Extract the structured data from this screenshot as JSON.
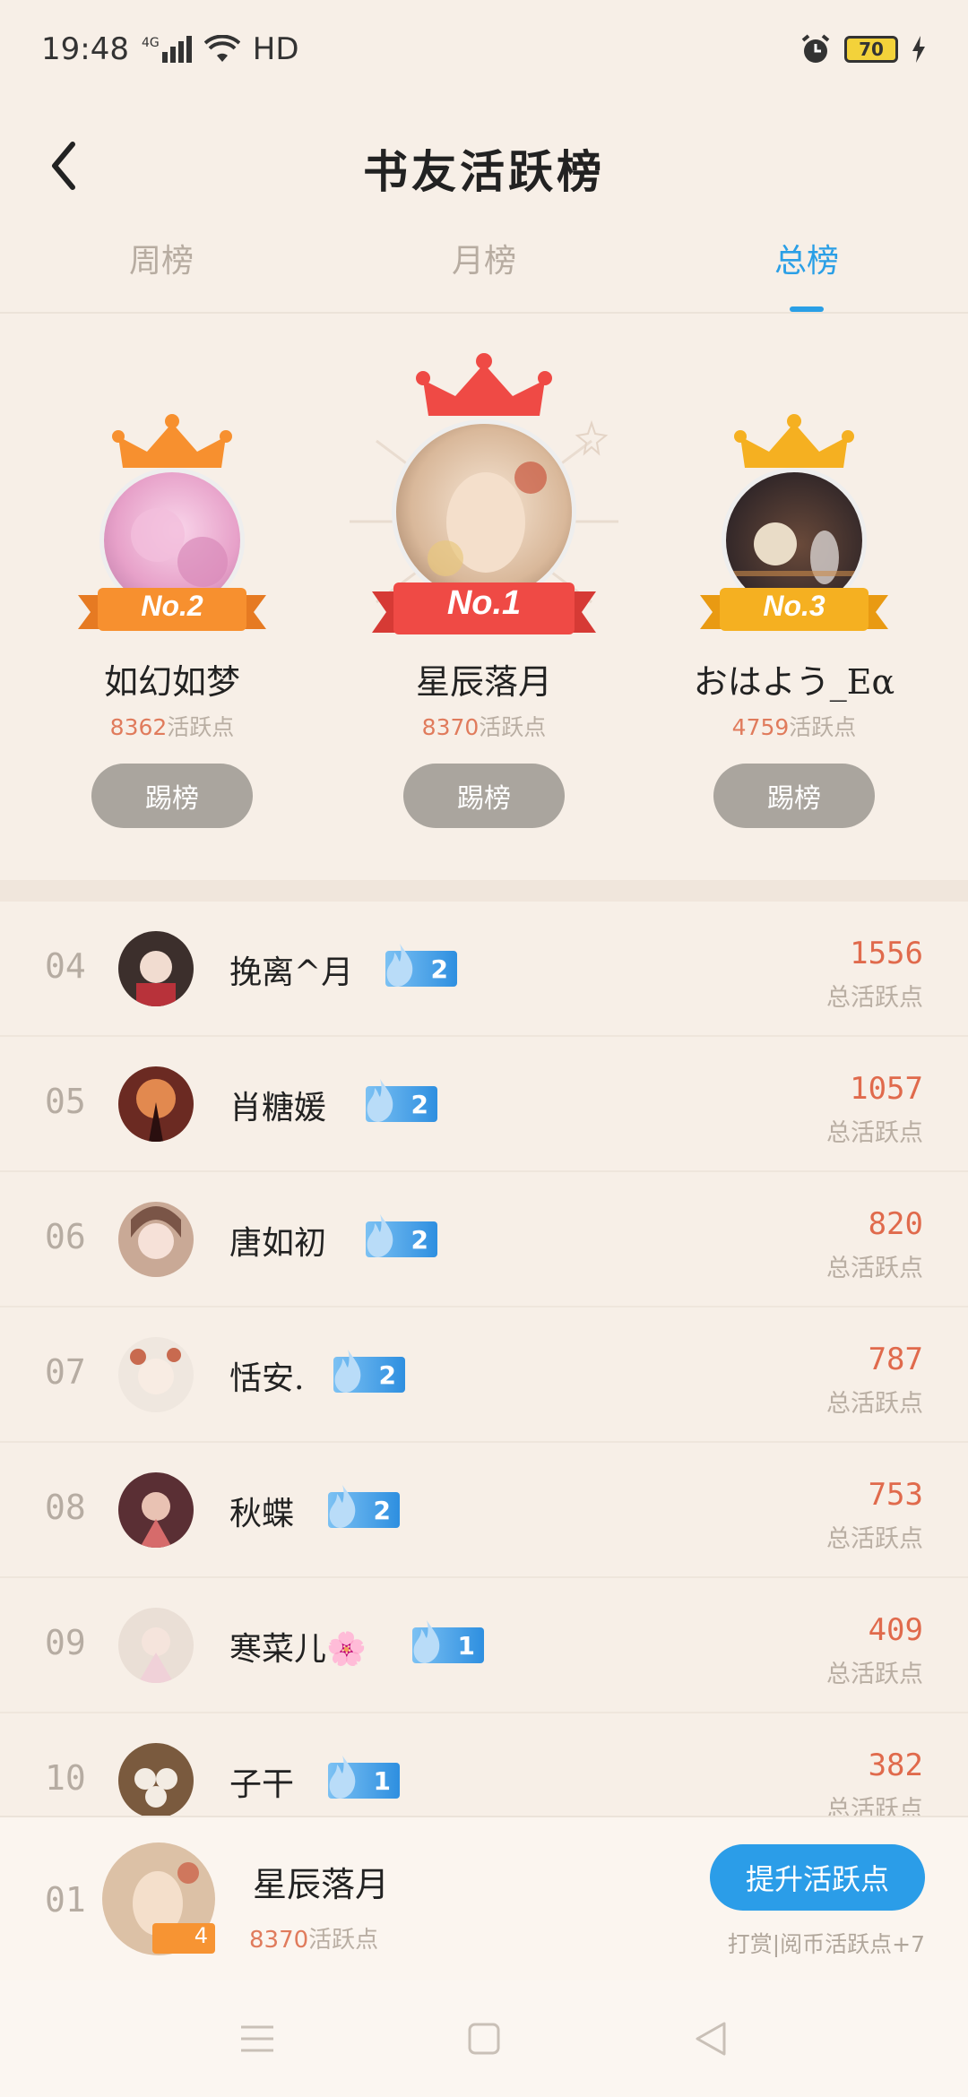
{
  "status": {
    "time": "19:48",
    "network": "4G",
    "hd": "HD",
    "battery": "70"
  },
  "header": {
    "title": "书友活跃榜"
  },
  "tabs": [
    {
      "label": "周榜",
      "active": false
    },
    {
      "label": "月榜",
      "active": false
    },
    {
      "label": "总榜",
      "active": true
    }
  ],
  "podium": {
    "second": {
      "rank_label": "No.2",
      "name": "如幻如梦",
      "points": "8362",
      "points_suffix": "活跃点",
      "button": "踢榜"
    },
    "first": {
      "rank_label": "No.1",
      "name": "星辰落月",
      "points": "8370",
      "points_suffix": "活跃点",
      "button": "踢榜"
    },
    "third": {
      "rank_label": "No.3",
      "name": "おはよう_Eα",
      "points": "4759",
      "points_suffix": "活跃点",
      "button": "踢榜"
    }
  },
  "list": [
    {
      "rank": "04",
      "name": "挽离^月",
      "level": "2",
      "score": "1556",
      "score_label": "总活跃点"
    },
    {
      "rank": "05",
      "name": "肖糖媛",
      "level": "2",
      "score": "1057",
      "score_label": "总活跃点"
    },
    {
      "rank": "06",
      "name": "唐如初",
      "level": "2",
      "score": "820",
      "score_label": "总活跃点"
    },
    {
      "rank": "07",
      "name": "恬安.",
      "level": "2",
      "score": "787",
      "score_label": "总活跃点"
    },
    {
      "rank": "08",
      "name": "秋蝶",
      "level": "2",
      "score": "753",
      "score_label": "总活跃点"
    },
    {
      "rank": "09",
      "name": "寒菜儿🌸",
      "level": "1",
      "score": "409",
      "score_label": "总活跃点"
    },
    {
      "rank": "10",
      "name": "子干",
      "level": "1",
      "score": "382",
      "score_label": "总活跃点"
    }
  ],
  "my_rank": {
    "rank": "01",
    "name": "星辰落月",
    "level": "4",
    "points": "8370",
    "points_suffix": "活跃点",
    "button": "提升活跃点",
    "hint": "打赏|阅币活跃点+7"
  },
  "colors": {
    "accent": "#2a9fe6",
    "score": "#e06a4c",
    "gold": "#f5a623",
    "red": "#ef4a45",
    "orange": "#f7902f"
  }
}
